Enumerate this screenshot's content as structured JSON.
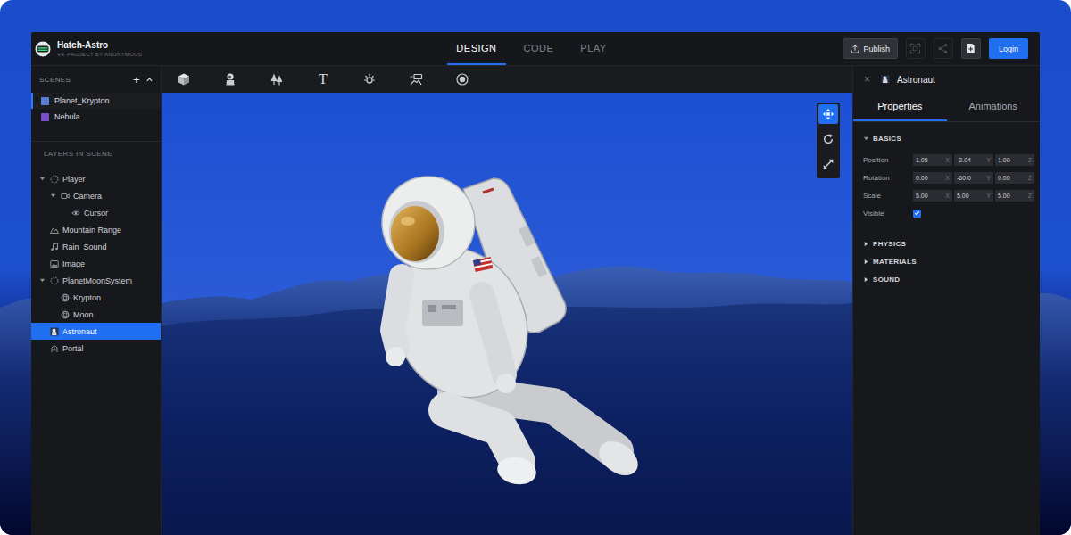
{
  "app": {
    "title": "Hatch-Astro",
    "subtitle": "VR PROJECT BY ANONYMOUS"
  },
  "mode_tabs": [
    {
      "label": "DESIGN",
      "selected": true
    },
    {
      "label": "CODE",
      "selected": false
    },
    {
      "label": "PLAY",
      "selected": false
    }
  ],
  "publish": {
    "label": "Publish"
  },
  "icon_buttons": [
    {
      "kind": "fullscreen",
      "disabled": true
    },
    {
      "kind": "share",
      "disabled": true
    },
    {
      "kind": "add-page",
      "disabled": false
    }
  ],
  "login": {
    "label": "Login"
  },
  "scenes": {
    "title": "SCENES",
    "add": "+",
    "expanded": true,
    "items": [
      {
        "name": "Planet_Krypton",
        "selected": true,
        "color": "#5b7fd6"
      },
      {
        "name": "Nebula",
        "selected": false,
        "color": "#7b4fc9"
      }
    ]
  },
  "layers": {
    "title": "LAYERS IN SCENE",
    "items": [
      {
        "name": "Player",
        "kind": "group",
        "selected": false,
        "expanded": true,
        "children": [
          {
            "name": "Camera",
            "kind": "camera",
            "selected": false,
            "expanded": true,
            "children": [
              {
                "name": "Cursor",
                "kind": "cursor",
                "selected": false
              }
            ]
          }
        ]
      },
      {
        "name": "Mountain Range",
        "kind": "terrain",
        "selected": false
      },
      {
        "name": "Rain_Sound",
        "kind": "sound",
        "selected": false
      },
      {
        "name": "Image",
        "kind": "image",
        "selected": false
      },
      {
        "name": "PlanetMoonSystem",
        "kind": "group",
        "selected": false,
        "expanded": true,
        "children": [
          {
            "name": "Krypton",
            "kind": "sphere",
            "selected": false
          },
          {
            "name": "Moon",
            "kind": "sphere",
            "selected": false
          }
        ]
      },
      {
        "name": "Astronaut",
        "kind": "model",
        "selected": true
      },
      {
        "name": "Portal",
        "kind": "portal",
        "selected": false
      }
    ]
  },
  "toolbar": [
    {
      "kind": "cube"
    },
    {
      "kind": "character"
    },
    {
      "kind": "trees"
    },
    {
      "kind": "text",
      "glyph": "T"
    },
    {
      "kind": "light"
    },
    {
      "kind": "sign"
    },
    {
      "kind": "target"
    }
  ],
  "gizmo": [
    {
      "kind": "move",
      "selected": true
    },
    {
      "kind": "rotate",
      "selected": false
    },
    {
      "kind": "scale",
      "selected": false
    }
  ],
  "inspector": {
    "close": "×",
    "title": "Astronaut",
    "tabs": [
      {
        "label": "Properties",
        "selected": true
      },
      {
        "label": "Animations",
        "selected": false
      }
    ],
    "sections": [
      {
        "title": "BASICS",
        "expanded": true,
        "fields": [
          {
            "label": "Position",
            "values": [
              {
                "value": "1.05",
                "axis": "X"
              },
              {
                "value": "-2.04",
                "axis": "Y"
              },
              {
                "value": "1.00",
                "axis": "Z"
              }
            ]
          },
          {
            "label": "Rotation",
            "values": [
              {
                "value": "0.00",
                "axis": "X"
              },
              {
                "value": "-60.0",
                "axis": "Y"
              },
              {
                "value": "0.00",
                "axis": "Z"
              }
            ]
          },
          {
            "label": "Scale",
            "values": [
              {
                "value": "5.00",
                "axis": "X"
              },
              {
                "value": "5.00",
                "axis": "Y"
              },
              {
                "value": "5.00",
                "axis": "Z"
              }
            ]
          }
        ],
        "visible": {
          "label": "Visible",
          "checked": true
        }
      },
      {
        "title": "PHYSICS",
        "expanded": false
      },
      {
        "title": "MATERIALS",
        "expanded": false
      },
      {
        "title": "SOUND",
        "expanded": false
      }
    ]
  }
}
